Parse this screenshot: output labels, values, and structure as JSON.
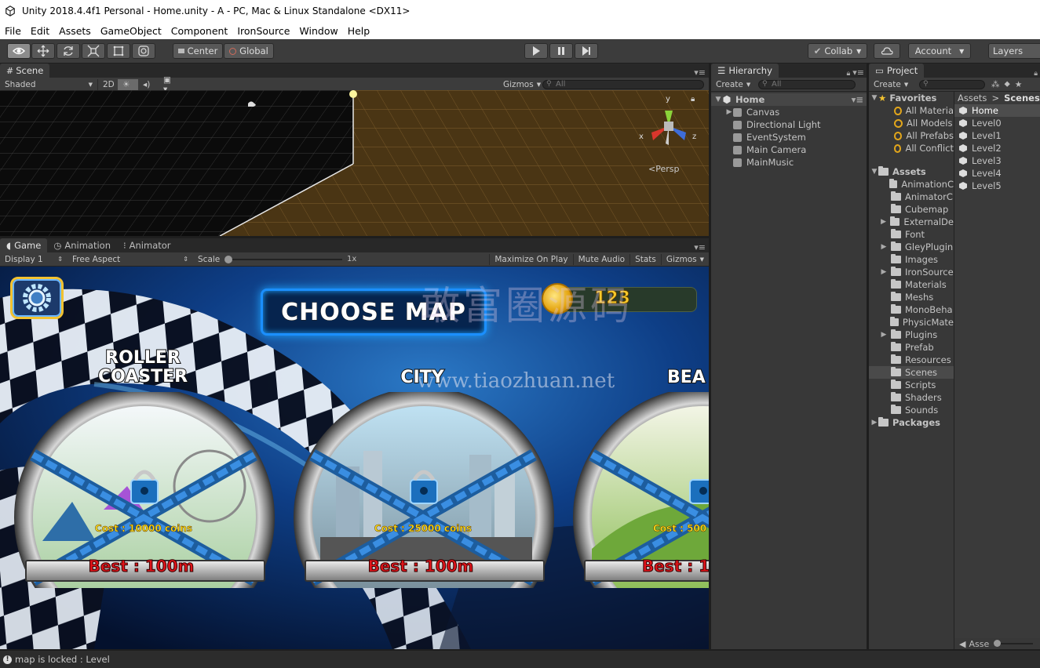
{
  "window": {
    "title": "Unity 2018.4.4f1 Personal - Home.unity - A - PC, Mac & Linux Standalone <DX11>"
  },
  "menu": [
    "File",
    "Edit",
    "Assets",
    "GameObject",
    "Component",
    "IronSource",
    "Window",
    "Help"
  ],
  "toolbar": {
    "center_label": "Center",
    "global_label": "Global",
    "collab_label": "Collab",
    "account_label": "Account",
    "layers_label": "Layers"
  },
  "scene": {
    "tab_label": "Scene",
    "shading": "Shaded",
    "mode_2d": "2D",
    "gizmos": "Gizmos",
    "search_placeholder": "All",
    "persp_label": "Persp",
    "axis_x": "x",
    "axis_y": "y",
    "axis_z": "z"
  },
  "game": {
    "tabs": [
      "Game",
      "Animation",
      "Animator"
    ],
    "display": "Display 1",
    "aspect": "Free Aspect",
    "scale_label": "Scale",
    "scale_value": "1x",
    "maximize": "Maximize On Play",
    "mute": "Mute Audio",
    "stats": "Stats",
    "gizmos": "Gizmos",
    "title": "CHOOSE MAP",
    "coins": "123",
    "watermark_cn": "敢富圈源码",
    "watermark_url": "www.tiaozhuan.net",
    "maps": [
      {
        "name_line1": "ROLLER",
        "name_line2": "COASTER",
        "cost": "Cost : 10000 coins",
        "best": "Best : 100m"
      },
      {
        "name_line1": "",
        "name_line2": "CITY",
        "cost": "Cost : 25000 coins",
        "best": "Best : 100m"
      },
      {
        "name_line1": "",
        "name_line2": "BEA",
        "cost": "Cost : 500",
        "best": "Best : 1"
      }
    ]
  },
  "hierarchy": {
    "tab_label": "Hierarchy",
    "create": "Create",
    "search_placeholder": "All",
    "scene_name": "Home",
    "items": [
      "Canvas",
      "Directional Light",
      "EventSystem",
      "Main Camera",
      "MainMusic"
    ]
  },
  "project": {
    "tab_label": "Project",
    "create": "Create",
    "favorites_label": "Favorites",
    "favorites": [
      "All Materia",
      "All Models",
      "All Prefabs",
      "All Conflict"
    ],
    "assets_label": "Assets",
    "folders": [
      {
        "name": "AnimationC",
        "expandable": false
      },
      {
        "name": "AnimatorC",
        "expandable": false
      },
      {
        "name": "Cubemap",
        "expandable": false
      },
      {
        "name": "ExternalDe",
        "expandable": true
      },
      {
        "name": "Font",
        "expandable": false
      },
      {
        "name": "GleyPlugin",
        "expandable": true
      },
      {
        "name": "Images",
        "expandable": false
      },
      {
        "name": "IronSource",
        "expandable": true
      },
      {
        "name": "Materials",
        "expandable": false
      },
      {
        "name": "Meshs",
        "expandable": false
      },
      {
        "name": "MonoBeha",
        "expandable": false
      },
      {
        "name": "PhysicMate",
        "expandable": false
      },
      {
        "name": "Plugins",
        "expandable": true
      },
      {
        "name": "Prefab",
        "expandable": false
      },
      {
        "name": "Resources",
        "expandable": false
      },
      {
        "name": "Scenes",
        "expandable": false
      },
      {
        "name": "Scripts",
        "expandable": false
      },
      {
        "name": "Shaders",
        "expandable": false
      },
      {
        "name": "Sounds",
        "expandable": false
      }
    ],
    "selected_folder": "Scenes",
    "packages_label": "Packages",
    "breadcrumb_root": "Assets",
    "breadcrumb_current": "Scenes",
    "scenes": [
      "Home",
      "Level0",
      "Level1",
      "Level2",
      "Level3",
      "Level4",
      "Level5"
    ],
    "bottom_label": "Asse"
  },
  "status": {
    "message": "map is locked : Level"
  }
}
